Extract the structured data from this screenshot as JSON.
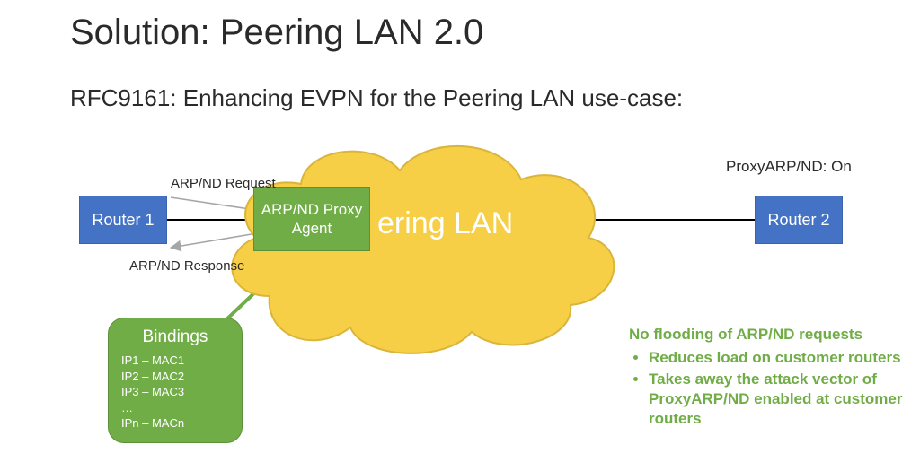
{
  "title": "Solution: Peering LAN 2.0",
  "subtitle": "RFC9161: Enhancing EVPN for the Peering LAN use-case:",
  "cloud_label": "ering LAN",
  "router1_label": "Router 1",
  "router2_label": "Router 2",
  "proxy_agent_label": "ARP/ND Proxy Agent",
  "arp_request_label": "ARP/ND Request",
  "arp_response_label": "ARP/ND Response",
  "proxy_on_label": "ProxyARP/ND: On",
  "bindings": {
    "title": "Bindings",
    "items": [
      "IP1 – MAC1",
      "IP2 – MAC2",
      "IP3 – MAC3",
      "…",
      "IPn – MACn"
    ]
  },
  "benefits": {
    "headline": "No flooding of ARP/ND requests",
    "items": [
      "Reduces load on customer routers",
      "Takes away the attack vector of ProxyARP/ND enabled at customer routers"
    ]
  },
  "colors": {
    "router_fill": "#4472c4",
    "green_fill": "#70ad47",
    "cloud_fill": "#f6cf46",
    "cloud_stroke": "#d9b53b"
  }
}
